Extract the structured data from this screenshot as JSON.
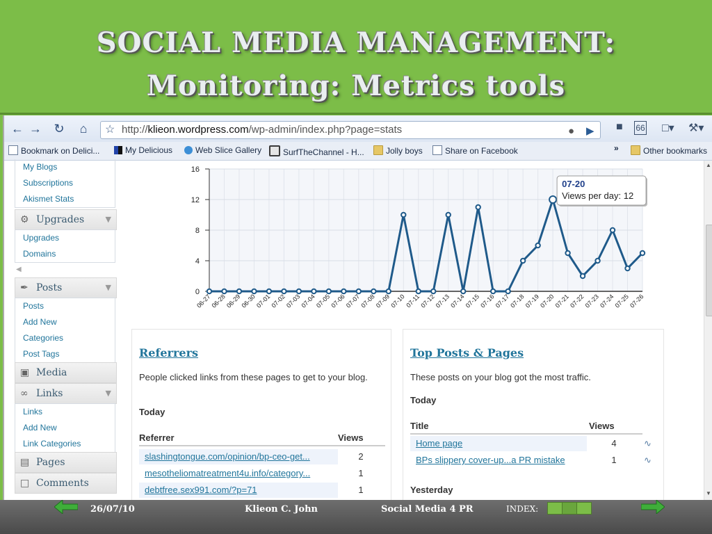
{
  "slide": {
    "title_line1": "SOCIAL MEDIA MANAGEMENT:",
    "title_line2": "Monitoring: Metrics tools"
  },
  "browser": {
    "url_prefix": "http://",
    "url_domain": "klieon.wordpress.com",
    "url_path": "/wp-admin/index.php?page=stats",
    "badge_count": "66",
    "bookmarks": [
      "Bookmark on Delici...",
      "My Delicious",
      "Web Slice Gallery",
      "SurfTheChannel - H...",
      "Jolly boys",
      "Share on Facebook"
    ],
    "more_bookmarks": "»",
    "other_bookmarks": "Other bookmarks"
  },
  "sidebar": {
    "top_items": [
      "My Blogs",
      "Subscriptions",
      "Akismet Stats"
    ],
    "upgrades": {
      "title": "Upgrades",
      "items": [
        "Upgrades",
        "Domains"
      ]
    },
    "posts": {
      "title": "Posts",
      "items": [
        "Posts",
        "Add New",
        "Categories",
        "Post Tags"
      ]
    },
    "media": {
      "title": "Media"
    },
    "links": {
      "title": "Links",
      "items": [
        "Links",
        "Add New",
        "Link Categories"
      ]
    },
    "pages": {
      "title": "Pages"
    },
    "comments": {
      "title": "Comments"
    }
  },
  "chart_data": {
    "type": "line",
    "categories": [
      "06-27",
      "06-28",
      "06-29",
      "06-30",
      "07-01",
      "07-02",
      "07-03",
      "07-04",
      "07-05",
      "07-06",
      "07-07",
      "07-08",
      "07-09",
      "07-10",
      "07-11",
      "07-12",
      "07-13",
      "07-14",
      "07-15",
      "07-16",
      "07-17",
      "07-18",
      "07-19",
      "07-20",
      "07-21",
      "07-22",
      "07-23",
      "07-24",
      "07-25",
      "07-26"
    ],
    "values": [
      0,
      0,
      0,
      0,
      0,
      0,
      0,
      0,
      0,
      0,
      0,
      0,
      0,
      10,
      0,
      0,
      10,
      0,
      11,
      0,
      0,
      4,
      6,
      12,
      5,
      2,
      4,
      8,
      3,
      5
    ],
    "yticks": [
      "0",
      "4",
      "8",
      "12",
      "16"
    ],
    "ylim": [
      0,
      16
    ],
    "grid": true,
    "tooltip": {
      "date": "07-20",
      "text": "Views per day: 12",
      "index": 23
    },
    "line_color": "#1f5a8a"
  },
  "referrers": {
    "title": "Referrers",
    "description": "People clicked links from these pages to get to your blog.",
    "period": "Today",
    "col_referrer": "Referrer",
    "col_views": "Views",
    "rows": [
      {
        "url": "slashingtongue.com/opinion/bp-ceo-get...",
        "views": "2"
      },
      {
        "url": "mesotheliomatreatment4u.info/category...",
        "views": "1"
      },
      {
        "url": "debtfree.sex991.com/?p=71",
        "views": "1"
      }
    ]
  },
  "top_posts": {
    "title": "Top Posts & Pages",
    "description": "These posts on your blog got the most traffic.",
    "period": "Today",
    "col_title": "Title",
    "col_views": "Views",
    "rows": [
      {
        "title": "Home page",
        "views": "4"
      },
      {
        "title": "BPs slippery cover-up...a PR mistake",
        "views": "1"
      }
    ],
    "period2": "Yesterday"
  },
  "footer": {
    "date": "26/07/10",
    "author": "Klieon C. John",
    "course": "Social Media 4 PR",
    "index_label": "INDEX:"
  },
  "colors": {
    "slide_green": "#7cbd48",
    "wp_link": "#21759b"
  }
}
